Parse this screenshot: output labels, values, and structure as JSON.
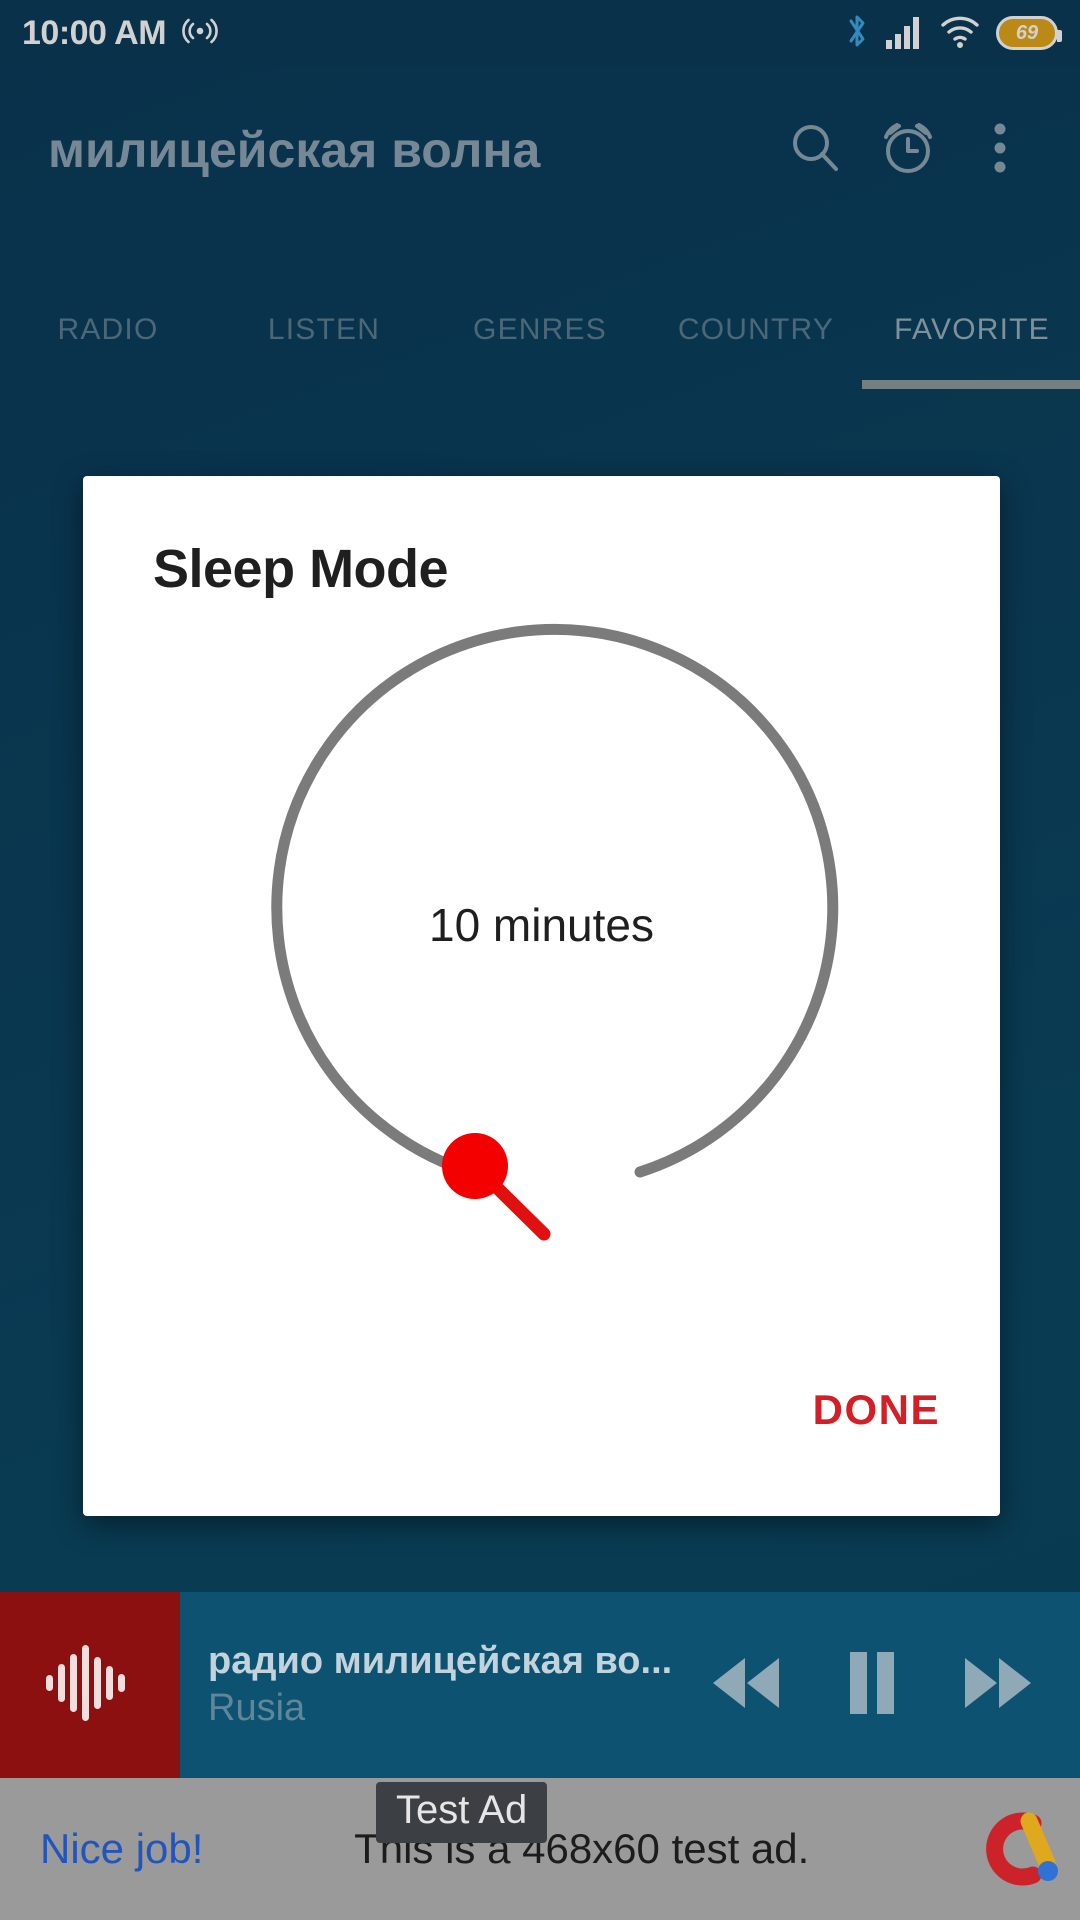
{
  "status_bar": {
    "time": "10:00 AM",
    "cast_icon": "broadcast-icon",
    "bluetooth_icon": "bluetooth-icon",
    "signal_icon": "cellular-signal-icon",
    "wifi_icon": "wifi-icon",
    "battery_percent": "69"
  },
  "app_bar": {
    "title": "милицейская волна",
    "search_icon": "search-icon",
    "alarm_icon": "alarm-clock-icon",
    "overflow_icon": "more-vertical-icon"
  },
  "tabs": {
    "items": [
      {
        "label": "RADIO",
        "active": false
      },
      {
        "label": "LISTEN",
        "active": false
      },
      {
        "label": "GENRES",
        "active": false
      },
      {
        "label": "COUNTRY",
        "active": false
      },
      {
        "label": "FAVORITE",
        "active": true
      }
    ],
    "indicator_color": "#8e9ba2"
  },
  "dialog": {
    "title": "Sleep Mode",
    "timer_value_label": "10 minutes",
    "timer_minutes": 10,
    "done_label": "DONE",
    "done_color": "#d32026",
    "track_color": "#7b7b7b",
    "knob_color": "#f40000"
  },
  "player": {
    "thumb_icon": "waveform-icon",
    "thumb_color": "#8c1010",
    "title": "радио милицейская во...",
    "subtitle": "Rusia",
    "rewind_icon": "rewind-icon",
    "pause_icon": "pause-icon",
    "forward_icon": "fast-forward-icon"
  },
  "ad": {
    "badge": "Test Ad",
    "cta": "Nice job!",
    "text": "This is a 468x60 test ad.",
    "logo_icon": "admob-logo-icon",
    "cta_color": "#2255bb"
  }
}
